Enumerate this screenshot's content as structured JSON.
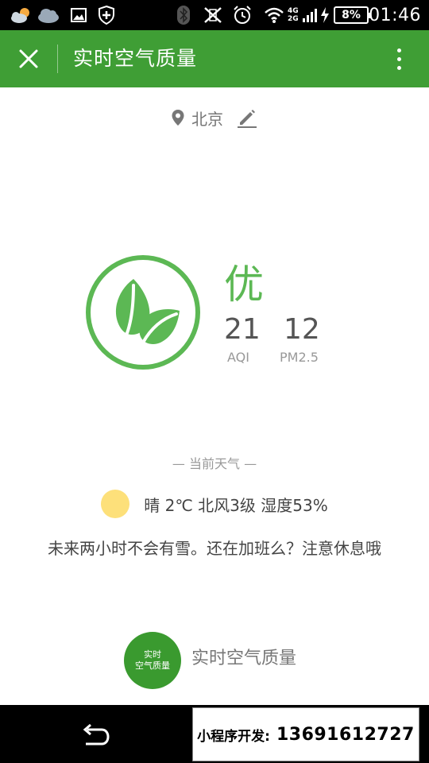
{
  "status_bar": {
    "icons": [
      "cloud-sun-icon",
      "cloud-icon",
      "image-icon",
      "shield-icon",
      "bluetooth-icon",
      "vibrate-off-icon",
      "alarm-icon",
      "wifi-icon",
      "signal-icon",
      "charging-icon"
    ],
    "network_top": "4G",
    "network_bottom": "2G",
    "battery": "8%",
    "time": "01:46"
  },
  "title_bar": {
    "title": "实时空气质量",
    "close_icon": "close-icon",
    "more_icon": "more-vertical-icon",
    "color": "#3f9e35"
  },
  "location": {
    "city": "北京",
    "pin_icon": "location-pin-icon",
    "edit_icon": "edit-pencil-icon"
  },
  "aqi": {
    "level": "优",
    "aqi_value": "21",
    "aqi_label": "AQI",
    "pm25_value": "12",
    "pm25_label": "PM2.5",
    "icon": "leaf-icon",
    "color": "#5cb854"
  },
  "weather": {
    "section_title": "— 当前天气 —",
    "icon": "sun-icon",
    "summary": "晴 2℃ 北风3级 湿度53%",
    "forecast": "未来两小时不会有雪。还在加班么？注意休息哦"
  },
  "brand": {
    "logo_line1": "实时",
    "logo_line2": "空气质量",
    "name": "实时空气质量"
  },
  "nav_bar": {
    "back_icon": "back-arrow-icon",
    "ad_label": "小程序开发:",
    "ad_phone": "13691612727"
  }
}
